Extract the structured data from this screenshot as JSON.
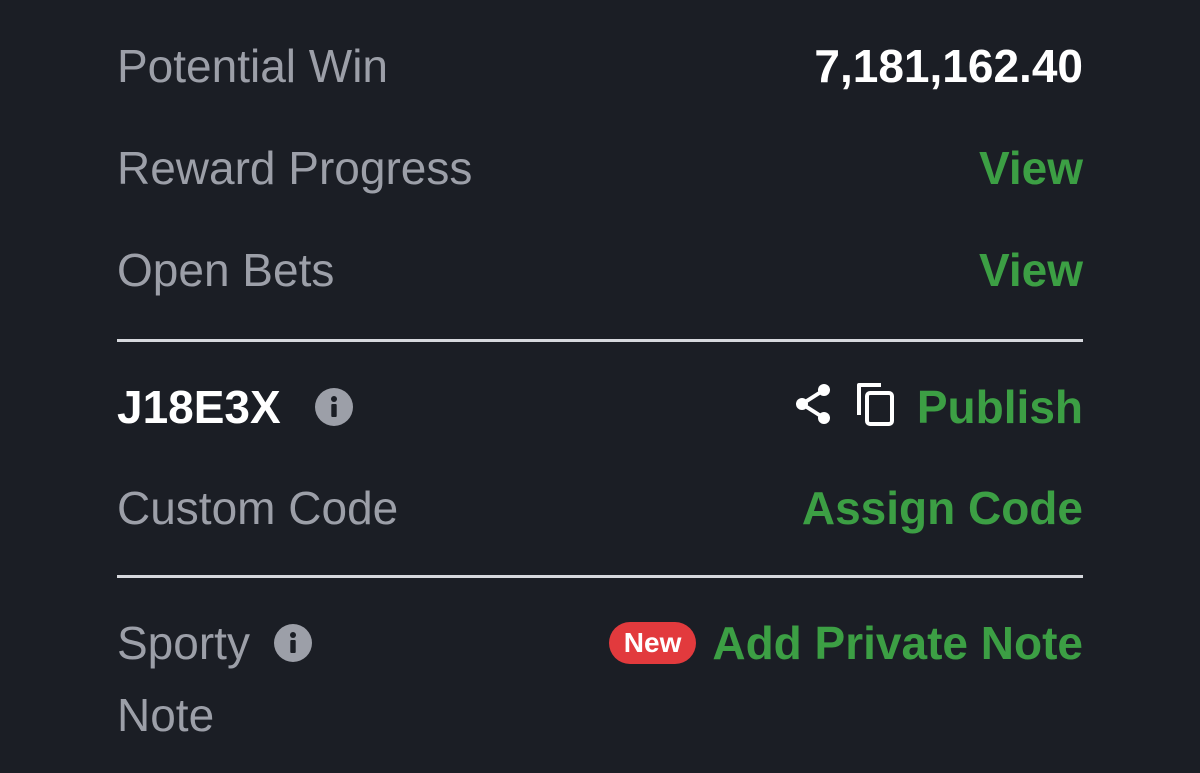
{
  "rows": {
    "potential_win": {
      "label": "Potential Win",
      "value": "7,181,162.40"
    },
    "reward_progress": {
      "label": "Reward Progress",
      "action": "View"
    },
    "open_bets": {
      "label": "Open Bets",
      "action": "View"
    }
  },
  "booking": {
    "code": "J18E3X",
    "info_icon": "info-icon",
    "share_icon": "share-icon",
    "copy_icon": "copy-icon",
    "publish_label": "Publish"
  },
  "custom_code": {
    "label": "Custom Code",
    "action": "Assign Code"
  },
  "note": {
    "label_line1": "Sporty",
    "label_line2": "Note",
    "badge": "New",
    "action": "Add Private Note"
  },
  "colors": {
    "background": "#1b1e25",
    "label": "#9c9fa8",
    "accent_green": "#3c9f44",
    "badge_red": "#e23a3d",
    "divider": "#d6d8dd"
  }
}
